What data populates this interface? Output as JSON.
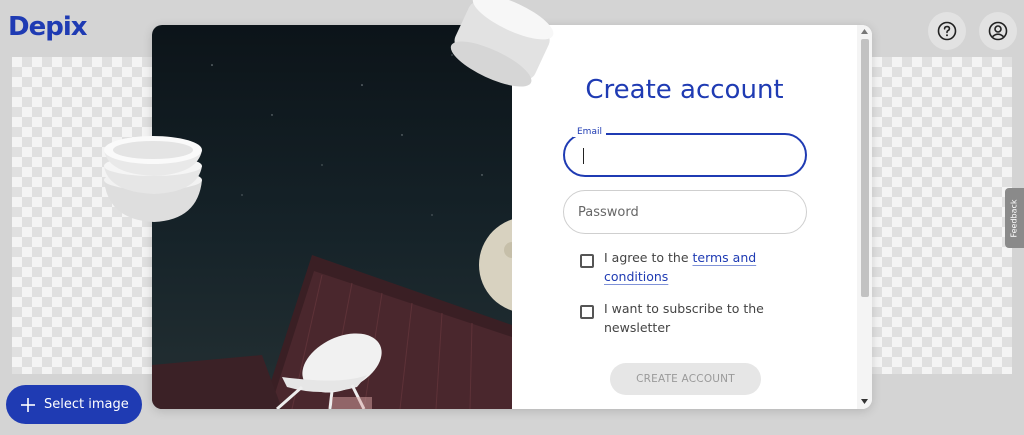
{
  "header": {
    "logo": "Depix",
    "help_icon": "question-circle-icon",
    "account_icon": "user-circle-icon"
  },
  "signup": {
    "title": "Create account",
    "email_label": "Email",
    "email_value": "",
    "password_placeholder": "Password",
    "terms_prefix": "I agree to the ",
    "terms_link": "terms and conditions",
    "terms_checked": false,
    "newsletter_text": "I want to subscribe to the newsletter",
    "newsletter_checked": false,
    "submit_label": "CREATE ACCOUNT"
  },
  "select_image": {
    "label": "Select image",
    "icon": "plus-icon"
  },
  "feedback_tab": "Feedback",
  "colors": {
    "brand": "#1f3bb3",
    "background": "#d4d4d4",
    "button_disabled": "#e6e6e6"
  }
}
